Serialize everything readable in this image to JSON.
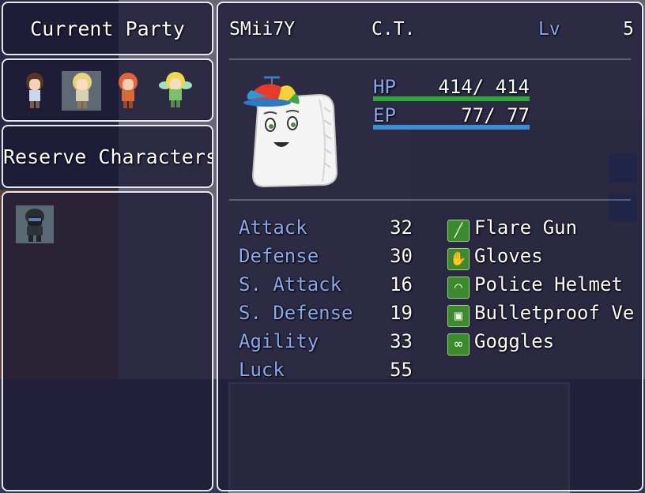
{
  "windows": {
    "current_party_title": "Current Party",
    "reserve_title": "Reserve Characters"
  },
  "party": [
    "brunette-girl",
    "blonde-elf-girl",
    "red-haired-fighter",
    "fairy-girl"
  ],
  "reserve": [
    "masked-soldier"
  ],
  "actor": {
    "name": "SMii7Y",
    "class": "C.T.",
    "lv_label": "Lv",
    "level": "5",
    "hp_label": "HP",
    "hp_current": "414",
    "hp_max": "414",
    "hp_ratio": 1.0,
    "ep_label": "EP",
    "ep_current": "77",
    "ep_max": "77",
    "ep_ratio": 1.0
  },
  "stats": [
    {
      "label": "Attack",
      "value": "32"
    },
    {
      "label": "Defense",
      "value": "30"
    },
    {
      "label": "S. Attack",
      "value": "16"
    },
    {
      "label": "S. Defense",
      "value": "19"
    },
    {
      "label": "Agility",
      "value": "33"
    },
    {
      "label": "Luck",
      "value": "55"
    }
  ],
  "equipment": [
    {
      "icon": "gun-icon",
      "name": "Flare Gun"
    },
    {
      "icon": "glove-icon",
      "name": "Gloves"
    },
    {
      "icon": "helmet-icon",
      "name": "Police Helmet"
    },
    {
      "icon": "vest-icon",
      "name": "Bulletproof Ves"
    },
    {
      "icon": "goggles-icon",
      "name": "Goggles"
    }
  ],
  "colors": {
    "hp_gauge": "#2fa83a",
    "ep_gauge": "#3a8ed6",
    "system_blue": "#8aa8ec",
    "window_border": "#e9e9f2"
  }
}
